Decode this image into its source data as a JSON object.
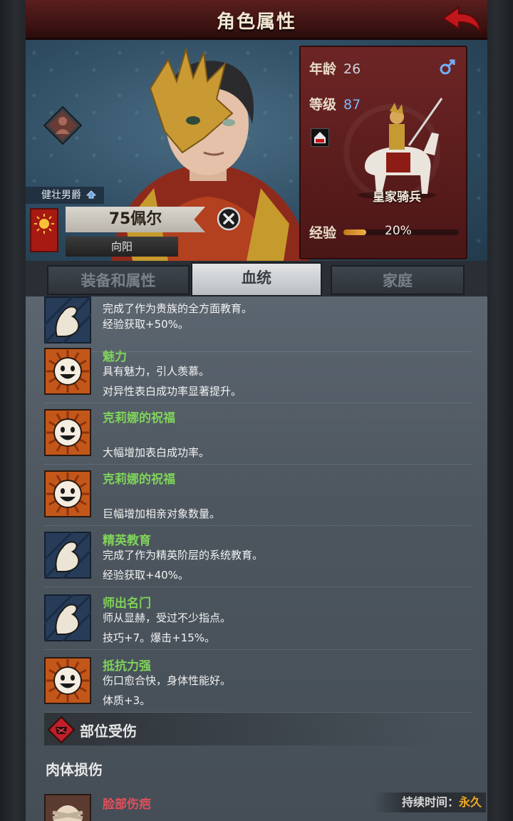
{
  "header": {
    "title": "角色属性"
  },
  "character": {
    "title_tag": "健壮男爵",
    "name": "75佩尔",
    "origin": "向阳",
    "age_label": "年龄",
    "age": "26",
    "level_label": "等级",
    "level": "87",
    "unit": "皇家骑兵",
    "exp_label": "经验",
    "exp_percent": "20%",
    "exp_fraction": 0.2
  },
  "tabs": [
    {
      "label": "装备和属性",
      "active": false
    },
    {
      "label": "血统",
      "active": true
    },
    {
      "label": "家庭",
      "active": false
    }
  ],
  "traits": [
    {
      "name": "",
      "icon": "arm-icon",
      "line1": "完成了作为贵族的全方面教育。",
      "line2": "经验获取+50%。"
    },
    {
      "name": "魅力",
      "icon": "smile-icon",
      "line1": "具有魅力，引人羡慕。",
      "line2": "对异性表白成功率显著提升。"
    },
    {
      "name": "克莉娜的祝福",
      "icon": "smile-icon",
      "line1": "",
      "line2": "大幅增加表白成功率。"
    },
    {
      "name": "克莉娜的祝福",
      "icon": "smile-icon",
      "line1": "",
      "line2": "巨幅增加相亲对象数量。"
    },
    {
      "name": "精英教育",
      "icon": "arm-icon",
      "line1": "完成了作为精英阶层的系统教育。",
      "line2": "经验获取+40%。"
    },
    {
      "name": "师出名门",
      "icon": "arm-icon",
      "line1": "师从显赫，受过不少指点。",
      "line2": "技巧+7。爆击+15%。"
    },
    {
      "name": "抵抗力强",
      "icon": "smile-icon",
      "line1": "伤口愈合快，身体性能好。",
      "line2": "体质+3。"
    }
  ],
  "injury_section": {
    "title": "部位受伤",
    "subtitle": "肉体损伤",
    "injury_name": "脸部伤疤",
    "duration_label": "持续时间：",
    "duration_value": "永久"
  },
  "colors": {
    "trait_name": "#7fd35a",
    "injury_name": "#e0505a",
    "exp_bar": "#f0b04a",
    "header": "#5a1e1e"
  }
}
